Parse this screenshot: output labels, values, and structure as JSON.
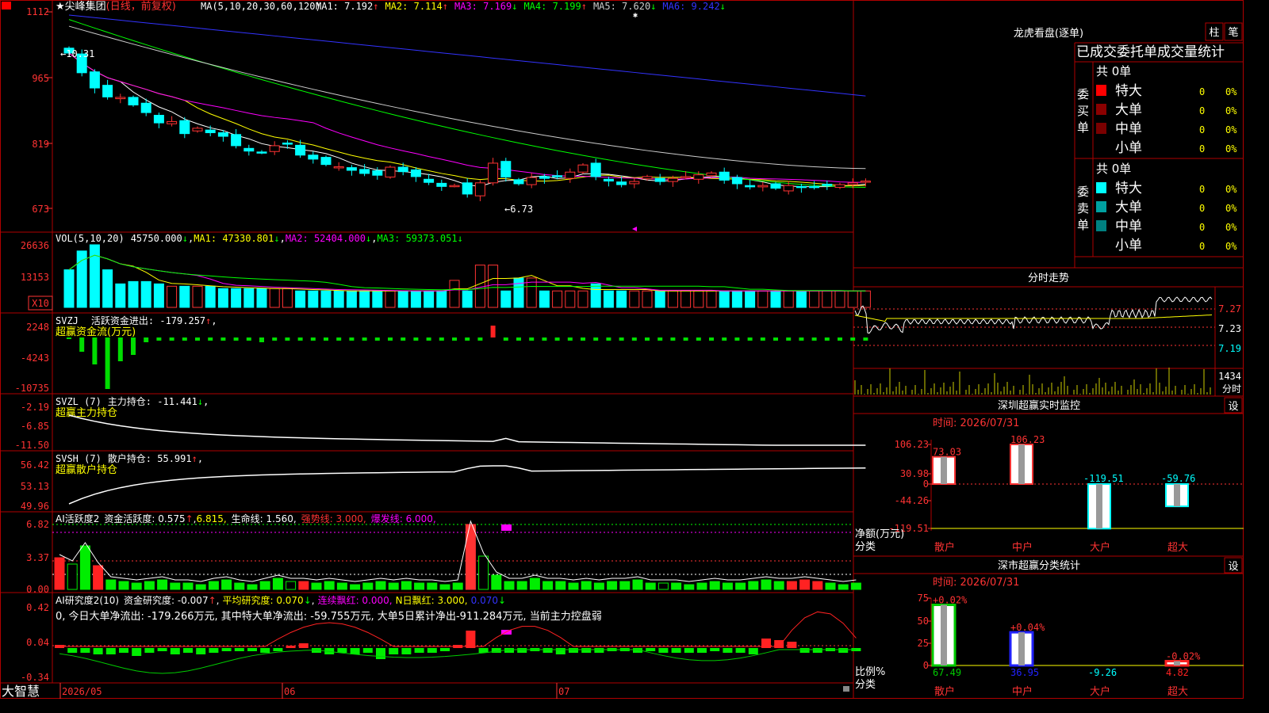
{
  "app": {
    "brand": "大智慧"
  },
  "main": {
    "stock_name": "尖峰集团",
    "mode": "(日线，前复权)",
    "ma_params": "MA(5,10,20,30,60,120)",
    "ma_values": [
      {
        "label": "MA1: 7.192",
        "color": "#ffffff"
      },
      {
        "label": "MA2: 7.114",
        "color": "#ffff00"
      },
      {
        "label": "MA3: 7.169",
        "color": "#ff00ff"
      },
      {
        "label": "MA4: 7.199",
        "color": "#00ff00"
      },
      {
        "label": "MA5: 7.620",
        "color": "#cccccc"
      },
      {
        "label": "MA6: 9.242",
        "color": "#3333ff"
      }
    ],
    "y_ticks": [
      "1112",
      "965",
      "819",
      "673"
    ],
    "high_label": "10.31",
    "low_label": "6.73",
    "close": 7.19
  },
  "chart_data": [
    {
      "type": "candlestick",
      "title": "尖峰集团 (日线，前复权)",
      "x_labels": [
        "2026/05",
        "06",
        "07"
      ],
      "close": [
        10.2,
        9.76,
        9.42,
        9.22,
        9.21,
        9.04,
        8.87,
        8.64,
        8.67,
        8.4,
        8.52,
        8.42,
        8.34,
        8.13,
        8.01,
        7.98,
        8.13,
        8.18,
        7.92,
        7.83,
        7.71,
        7.66,
        7.58,
        7.51,
        7.47,
        7.65,
        7.55,
        7.44,
        7.31,
        7.22,
        7.24,
        7.05,
        7.3,
        7.74,
        7.43,
        7.28,
        7.42,
        7.4,
        7.44,
        7.54,
        7.7,
        7.44,
        7.34,
        7.26,
        7.33,
        7.44,
        7.33,
        7.4,
        7.44,
        7.48,
        7.52,
        7.36,
        7.28,
        7.21,
        7.24,
        7.18,
        7.24,
        7.2,
        7.21,
        7.24,
        7.26,
        7.3,
        7.34
      ],
      "y_axis_ticks": [
        11.12,
        9.65,
        8.19,
        6.73
      ],
      "ma_series": [
        "MA1",
        "MA2",
        "MA3",
        "MA4",
        "MA5",
        "MA6"
      ]
    },
    {
      "type": "bar",
      "title": "VOL(5,10,20)",
      "y_axis_ticks": [
        26636,
        13153
      ],
      "values": [
        16000,
        24000,
        26636,
        16000,
        10000,
        11000,
        11000,
        10000,
        9000,
        9000,
        9000,
        9000,
        8000,
        8000,
        8000,
        8000,
        8000,
        8000,
        7000,
        7000,
        7000,
        7000,
        7000,
        7000,
        7000,
        7000,
        7000,
        7000,
        7000,
        7000,
        11500,
        7000,
        18000,
        18000,
        7000,
        12500,
        12500,
        7000,
        7000,
        7000,
        7000,
        10000,
        7000,
        7000,
        7000,
        7000,
        7000,
        7000,
        7000,
        7000,
        7000,
        7000,
        7000,
        7000,
        7000,
        7000,
        7000,
        7000,
        7000,
        7000,
        7000,
        7000,
        7000
      ],
      "lines": [
        {
          "name": "MA1",
          "value": 47330.801
        },
        {
          "name": "MA2",
          "value": 52404.0
        },
        {
          "name": "MA3",
          "value": 59373.051
        }
      ],
      "current": 45750.0
    }
  ],
  "vol": {
    "label": "VOL(5,10,20)",
    "value": "45750.000",
    "mas": [
      {
        "label": "MA1: 47330.801",
        "color": "#ffff00"
      },
      {
        "label": "MA2: 52404.000",
        "color": "#ff00ff"
      },
      {
        "label": "MA3: 59373.051",
        "color": "#00ff00"
      }
    ],
    "y_ticks": [
      "26636",
      "13153"
    ],
    "unit": "X10"
  },
  "svzj": {
    "label": "SVZJ",
    "title": "活跃资金进出: -179.257",
    "subtitle": "超赢资金流(万元)",
    "y_ticks": [
      "2248",
      "-4243",
      "-10735"
    ]
  },
  "svzl": {
    "label": "SVZL (7)",
    "title": "主力持仓: -11.441",
    "subtitle": "超赢主力持仓",
    "y_ticks": [
      "-2.19",
      "-6.85",
      "-11.50"
    ]
  },
  "svsh": {
    "label": "SVSH (7)",
    "title": "散户持仓: 55.991",
    "subtitle": "超赢散户持仓",
    "y_ticks": [
      "56.42",
      "53.13",
      "49.96"
    ]
  },
  "ai_active": {
    "label": "AI活跃度2",
    "fund": "资金活跃度: 0.575",
    "v2": "6.815,",
    "life": "生命线: 1.560,",
    "strong": "强势线: 3.000,",
    "burst": "爆发线: 6.000,",
    "y_ticks": [
      "6.82",
      "3.37",
      "0.00"
    ]
  },
  "ai_research": {
    "label": "AI研究度2(10)",
    "fund": "资金研究度: -0.007",
    "avg": "平均研究度: 0.070",
    "consec": "连续飘红: 0.000,",
    "nday": "N日飘红: 3.000,",
    "v5": "0.070",
    "summary": "0, 今日大单净流出: -179.266万元, 其中特大单净流出: -59.755万元, 大单5日累计净出-911.284万元, 当前主力控盘弱",
    "y_ticks": [
      "0.42",
      "0.04",
      "-0.34"
    ]
  },
  "lhb": {
    "title": "龙虎看盘(逐单)",
    "btn_bar": "柱",
    "btn_pen": "笔",
    "header": "已成交委托单成交量统计",
    "buy_label": "委买单",
    "sell_label": "委卖单",
    "buy_total": "共 0单",
    "sell_total": "共 0单",
    "buy_rows": [
      {
        "name": "特大",
        "color": "#ff0000",
        "count": "0",
        "pct": "0%"
      },
      {
        "name": "大单",
        "color": "#8b0000",
        "count": "0",
        "pct": "0%"
      },
      {
        "name": "中单",
        "color": "#7a0000",
        "count": "0",
        "pct": "0%"
      },
      {
        "name": "小单",
        "color": "",
        "count": "0",
        "pct": "0%"
      }
    ],
    "sell_rows": [
      {
        "name": "特大",
        "color": "#00ffff",
        "count": "0",
        "pct": "0%"
      },
      {
        "name": "大单",
        "color": "#00a0a0",
        "count": "0",
        "pct": "0%"
      },
      {
        "name": "中单",
        "color": "#008080",
        "count": "0",
        "pct": "0%"
      },
      {
        "name": "小单",
        "color": "",
        "count": "0",
        "pct": "0%"
      }
    ]
  },
  "intraday": {
    "title": "分时走势",
    "price_ticks": [
      "7.27",
      "7.23",
      "7.19"
    ],
    "vol_tick": "1434",
    "vol_unit": "分时"
  },
  "sz_monitor": {
    "title": "深圳超赢实时监控",
    "btn": "设",
    "time": "时间: 2026/07/31",
    "y_ticks": [
      "106.23",
      "30.98",
      "0",
      "-44.26",
      "-119.51"
    ],
    "y_label": "净额(万元)",
    "x_label": "分类",
    "bars": [
      {
        "name": "散户",
        "value": 73.03
      },
      {
        "name": "中户",
        "value": 106.23
      },
      {
        "name": "大户",
        "value": -119.51
      },
      {
        "name": "超大",
        "value": -59.76
      }
    ],
    "value_labels": [
      "73.03",
      "106.23",
      "-119.51",
      "-59.76"
    ]
  },
  "sz_stats": {
    "title": "深市超赢分类统计",
    "btn": "设",
    "time": "时间: 2026/07/31",
    "y_ticks": [
      "75",
      "50",
      "25",
      "0"
    ],
    "y_label": "比例%",
    "x_label": "分类",
    "bars": [
      {
        "name": "散户",
        "pct_change": "+0.02%",
        "value": 67.49,
        "value_label": "67.49",
        "color": "#00cc00"
      },
      {
        "name": "中户",
        "pct_change": "+0.04%",
        "value": 36.95,
        "value_label": "36.95",
        "color": "#2222ff"
      },
      {
        "name": "大户",
        "pct_change": "",
        "value": -9.26,
        "value_label": "-9.26",
        "color": "#00ffff"
      },
      {
        "name": "超大",
        "pct_change": "-0.02%",
        "value": 4.82,
        "value_label": "4.82",
        "color": "#ff2222"
      }
    ]
  }
}
